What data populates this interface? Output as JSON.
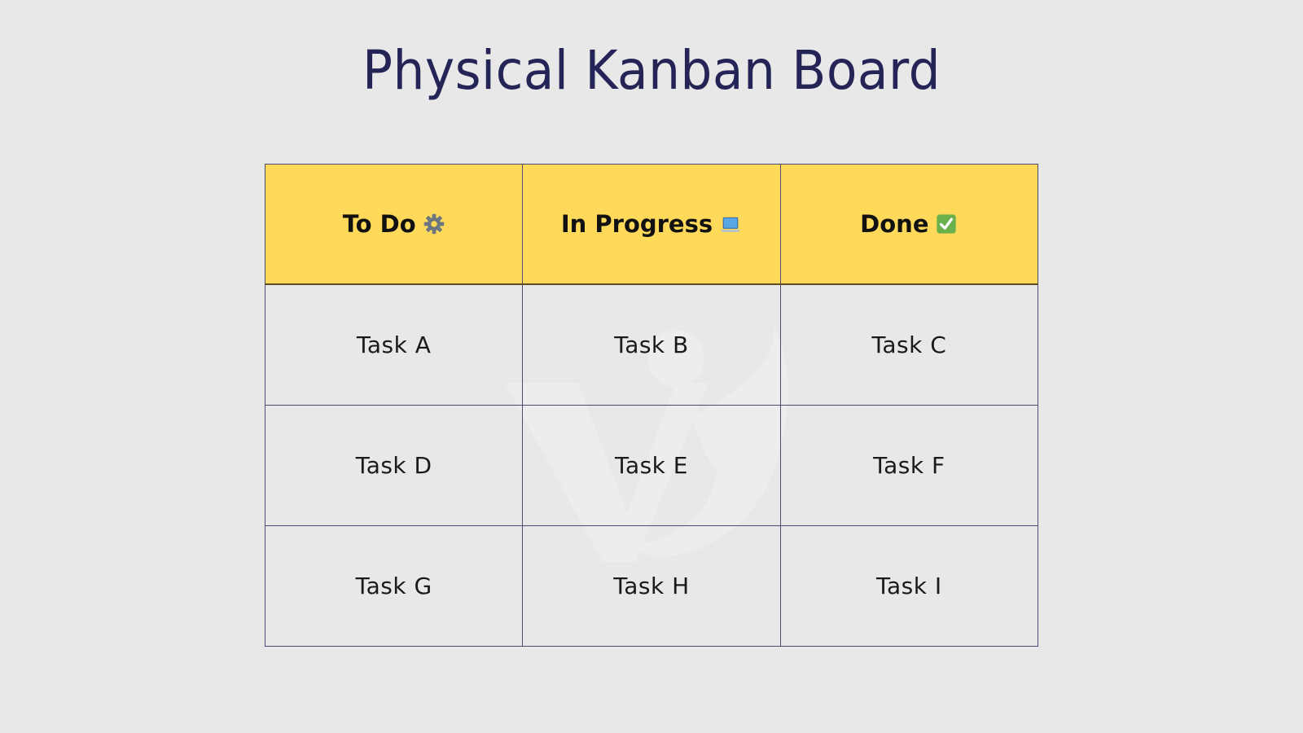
{
  "title": "Physical Kanban Board",
  "board": {
    "columns": [
      {
        "label": "To Do",
        "icon": "gear-icon"
      },
      {
        "label": "In Progress",
        "icon": "laptop-icon"
      },
      {
        "label": "Done",
        "icon": "check-mark-icon"
      }
    ],
    "rows": [
      [
        "Task A",
        "Task B",
        "Task C"
      ],
      [
        "Task D",
        "Task E",
        "Task F"
      ],
      [
        "Task G",
        "Task H",
        "Task I"
      ]
    ]
  },
  "colors": {
    "header_bg": "#ffd95a",
    "title": "#252456",
    "grid": "#4a4a72",
    "background": "#e8e8e8",
    "check_green": "#6ab04c",
    "laptop_blue": "#5aa7e6",
    "gear_gray": "#6b7680"
  }
}
